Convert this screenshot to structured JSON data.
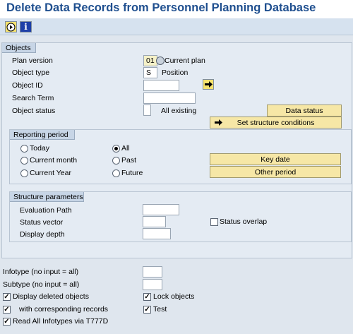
{
  "window": {
    "title": "Delete Data Records from Personnel Planning Database"
  },
  "toolbar": {
    "execute_icon": "execute-icon",
    "info_icon": "info-icon",
    "info_glyph": "i"
  },
  "objects": {
    "title": "Objects",
    "plan_version": {
      "label": "Plan version",
      "value": "01",
      "text": "Current plan"
    },
    "object_type": {
      "label": "Object type",
      "value": "S",
      "text": "Position"
    },
    "object_id": {
      "label": "Object ID",
      "value": ""
    },
    "search_term": {
      "label": "Search Term",
      "value": ""
    },
    "object_status": {
      "label": "Object status",
      "value": "",
      "text": "All existing"
    },
    "data_status_button": "Data status",
    "structure_conditions_button": "Set structure conditions"
  },
  "reporting": {
    "title": "Reporting period",
    "today": "Today",
    "current_month": "Current month",
    "current_year": "Current Year",
    "all": "All",
    "past": "Past",
    "future": "Future",
    "selected": "All",
    "key_date_button": "Key date",
    "other_period_button": "Other period"
  },
  "structure": {
    "title": "Structure parameters",
    "evaluation_path": {
      "label": "Evaluation Path",
      "value": ""
    },
    "status_vector": {
      "label": "Status vector",
      "value": ""
    },
    "display_depth": {
      "label": "Display depth",
      "value": ""
    },
    "status_overlap": {
      "label": "Status overlap",
      "checked": false
    }
  },
  "options": {
    "infotype": {
      "label": "Infotype (no input = all)",
      "value": ""
    },
    "subtype": {
      "label": "Subtype (no input = all)",
      "value": ""
    },
    "display_deleted": {
      "label": "Display deleted objects",
      "checked": true
    },
    "with_corresponding": {
      "label": "with corresponding records",
      "checked": true
    },
    "read_all_infotypes": {
      "label": "Read All Infotypes via T777D",
      "checked": true
    },
    "lock_objects": {
      "label": "Lock objects",
      "checked": true
    },
    "test": {
      "label": "Test",
      "checked": true
    }
  },
  "colors": {
    "title": "#1f4f8f",
    "button": "#f6e7a6",
    "background": "#dfe6ee"
  }
}
